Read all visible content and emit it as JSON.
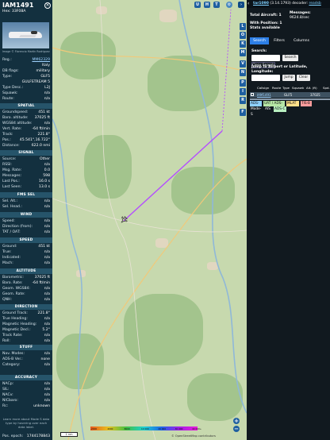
{
  "aircraft": {
    "callsign": "IAM1491",
    "hex_label": "Hex:  33F08A",
    "photo_credit": "Image © Florencio Martín Rodriguez",
    "reg_label": "Reg.:",
    "reg_value": "MM62329",
    "country": "Italy",
    "rows_top": [
      {
        "k": "DB flags:",
        "v": "military"
      },
      {
        "k": "Type:",
        "v": "GLF5"
      },
      {
        "k": "",
        "v": "GULFSTREAM 5"
      },
      {
        "k": "Type Desc.:",
        "v": "L2J"
      },
      {
        "k": "Squawk:",
        "v": "n/a"
      },
      {
        "k": "Route:",
        "v": "n/a"
      }
    ],
    "sections": {
      "spatial": "SPATIAL",
      "signal": "SIGNAL",
      "fms": "FMS SEL",
      "wind": "WIND",
      "speed": "SPEED",
      "altitude": "ALTITUDE",
      "direction": "DIRECTION",
      "stuff": "STUFF",
      "accuracy": "ACCURACY"
    },
    "spatial_rows": [
      {
        "k": "Groundspeed:",
        "v": "451 kt"
      },
      {
        "k": "Baro. altitude:",
        "v": "37025 ft"
      },
      {
        "k": "WGS84 altitude:",
        "v": "n/a"
      },
      {
        "k": "Vert. Rate:",
        "v": "-64 ft/min"
      },
      {
        "k": "Track:",
        "v": "221.8°"
      },
      {
        "k": "Pos.:",
        "v": "45.541°,16.722°"
      },
      {
        "k": "Distance:",
        "v": "622.0 nmi"
      }
    ],
    "signal_rows": [
      {
        "k": "Source:",
        "v": "Other"
      },
      {
        "k": "RSSI:",
        "v": "n/a"
      },
      {
        "k": "Msg. Rate:",
        "v": "0.0"
      },
      {
        "k": "Messages:",
        "v": "598"
      },
      {
        "k": "Last Pos.:",
        "v": "16.0 s"
      },
      {
        "k": "Last Seen:",
        "v": "13.0 s"
      }
    ],
    "fms_rows": [
      {
        "k": "Sel. Alt.:",
        "v": "n/a"
      },
      {
        "k": "Sel. Head.:",
        "v": "n/a"
      }
    ],
    "wind_rows": [
      {
        "k": "Speed:",
        "v": "n/a"
      },
      {
        "k": "Direction (from):",
        "v": "n/a"
      },
      {
        "k": "TAT / OAT:",
        "v": "n/a"
      }
    ],
    "speed_rows": [
      {
        "k": "Ground:",
        "v": "451 kt"
      },
      {
        "k": "True:",
        "v": "n/a"
      },
      {
        "k": "Indicated:",
        "v": "n/a"
      },
      {
        "k": "Mach:",
        "v": "n/a"
      }
    ],
    "altitude_rows": [
      {
        "k": "Barometric:",
        "v": "37025 ft"
      },
      {
        "k": "Baro. Rate:",
        "v": "-64 ft/min"
      },
      {
        "k": "Geom. WGS84:",
        "v": "n/a"
      },
      {
        "k": "Geom. Rate:",
        "v": "n/a"
      },
      {
        "k": "QNH:",
        "v": "n/a"
      }
    ],
    "direction_rows": [
      {
        "k": "Ground Track:",
        "v": "221.8°"
      },
      {
        "k": "True Heading:",
        "v": "n/a"
      },
      {
        "k": "Magnetic Heading:",
        "v": "n/a"
      },
      {
        "k": "Magnetic Decl.:",
        "v": "5.2°"
      },
      {
        "k": "Track Rate:",
        "v": "n/a"
      },
      {
        "k": "Roll:",
        "v": "n/a"
      }
    ],
    "stuff_rows": [
      {
        "k": "Nav. Modes:",
        "v": "n/a"
      },
      {
        "k": "ADS-B Ver.:",
        "v": "none"
      },
      {
        "k": "Category:",
        "v": "n/a"
      }
    ],
    "accuracy_rows": [
      {
        "k": "NACp:",
        "v": "n/a"
      },
      {
        "k": "SIL:",
        "v": "n/a"
      },
      {
        "k": "NACv:",
        "v": "n/a"
      },
      {
        "k": "NICbaro:",
        "v": "n/a"
      },
      {
        "k": "Rc:",
        "v": "unknown"
      }
    ],
    "learn_more": "Learn more about Mode S data type by hovering over each data label.",
    "epoch_label": "Pos. epoch:",
    "epoch_value": "1744178843"
  },
  "map": {
    "top_buttons": [
      "U",
      "H",
      "T"
    ],
    "side_buttons": [
      "L",
      "O",
      "K",
      "M",
      "V",
      "N",
      "P",
      "I",
      "R",
      "F"
    ],
    "zoom_in": "+",
    "zoom_out": "−",
    "scale_label": "1 nm",
    "attribution": "© OpenStreetMap contributors",
    "track_color": "#b44dff",
    "altitude_legend": [
      "-2000",
      "4000",
      "8000",
      "10 000",
      "20 000",
      "30 000",
      "40 000+"
    ]
  },
  "panel": {
    "brand": "tar1090",
    "version": "(3.14.1793)",
    "decoder_label": "decoder:",
    "decoder_link": "readsb",
    "total_aircraft": "Total Aircraft: 1",
    "messages": "Messages:",
    "messages_rate": "9624.8/sec",
    "with_position": "With Position: 1",
    "stats_available": "Stats available",
    "tabs": [
      "Search",
      "Filters",
      "Columns"
    ],
    "search_label": "Search:",
    "search_button": "Search",
    "clear_search": "Clear Search",
    "jump_label": "Jump to Airport or Latitude, Longitude:",
    "jump_button": "Jump",
    "clear_button": "Clear",
    "columns": [
      "Callsign",
      "Route",
      "Type",
      "Squawk",
      "Alt. (ft)",
      "Spd."
    ],
    "row": {
      "callsign": "IAM1491",
      "type": "GLF5",
      "alt": "37025"
    },
    "source_tags": [
      {
        "label": "ADS-B",
        "color": "#8fd2ff"
      },
      {
        "label": "UAT / ADS-R",
        "color": "#b7e7a6"
      },
      {
        "label": "MLAT",
        "color": "#ffe08a"
      },
      {
        "label": "TIS-B",
        "color": "#ff9d9d"
      },
      {
        "label": "Mode-S",
        "color": "#ffffff"
      },
      {
        "label": "AIS",
        "color": "#ffffff"
      },
      {
        "label": "ADS-C",
        "color": "#b9f0c0"
      }
    ]
  }
}
